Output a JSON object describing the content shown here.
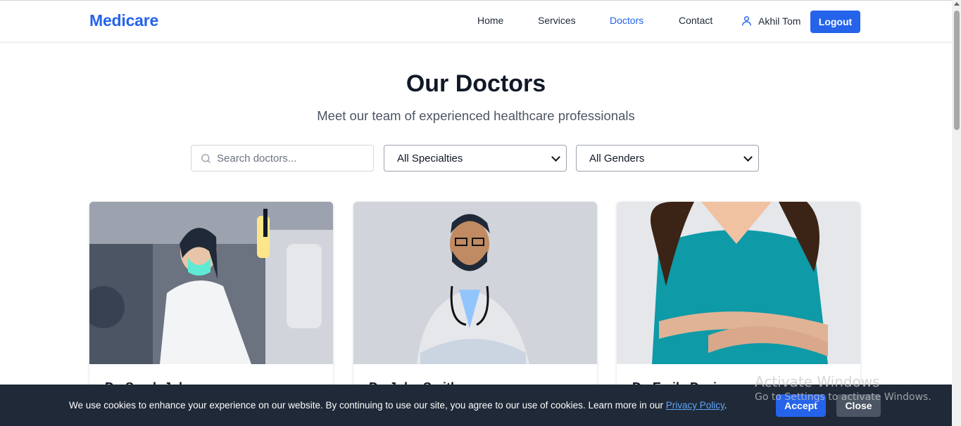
{
  "brand": "Medicare",
  "nav": {
    "home": "Home",
    "services": "Services",
    "doctors": "Doctors",
    "contact": "Contact",
    "user_name": "Akhil Tom",
    "logout": "Logout",
    "active_color": "#2563eb"
  },
  "hero": {
    "title": "Our Doctors",
    "subtitle": "Meet our team of experienced healthcare professionals"
  },
  "filters": {
    "search_placeholder": "Search doctors...",
    "specialty_selected": "All Specialties",
    "gender_selected": "All Genders"
  },
  "doctors": [
    {
      "name_partial": "Dr. Sarah Johnson",
      "image": "doctor-woman-lab-photo"
    },
    {
      "name_partial": "Dr. John Smith",
      "image": "doctor-man-stethoscope-photo"
    },
    {
      "name_partial": "Dr. Emily Davis",
      "image": "doctor-woman-scrubs-photo"
    }
  ],
  "cookie": {
    "message": "We use cookies to enhance your experience on our website. By continuing to use our site, you agree to our use of cookies. Learn more in our ",
    "link": "Privacy Policy",
    "period": ".",
    "accept": "Accept",
    "close": "Close"
  },
  "watermark": {
    "title": "Activate Windows",
    "subtitle": "Go to Settings to activate Windows."
  },
  "colors": {
    "primary": "#2563eb",
    "cookie_bg": "#1f2937"
  }
}
